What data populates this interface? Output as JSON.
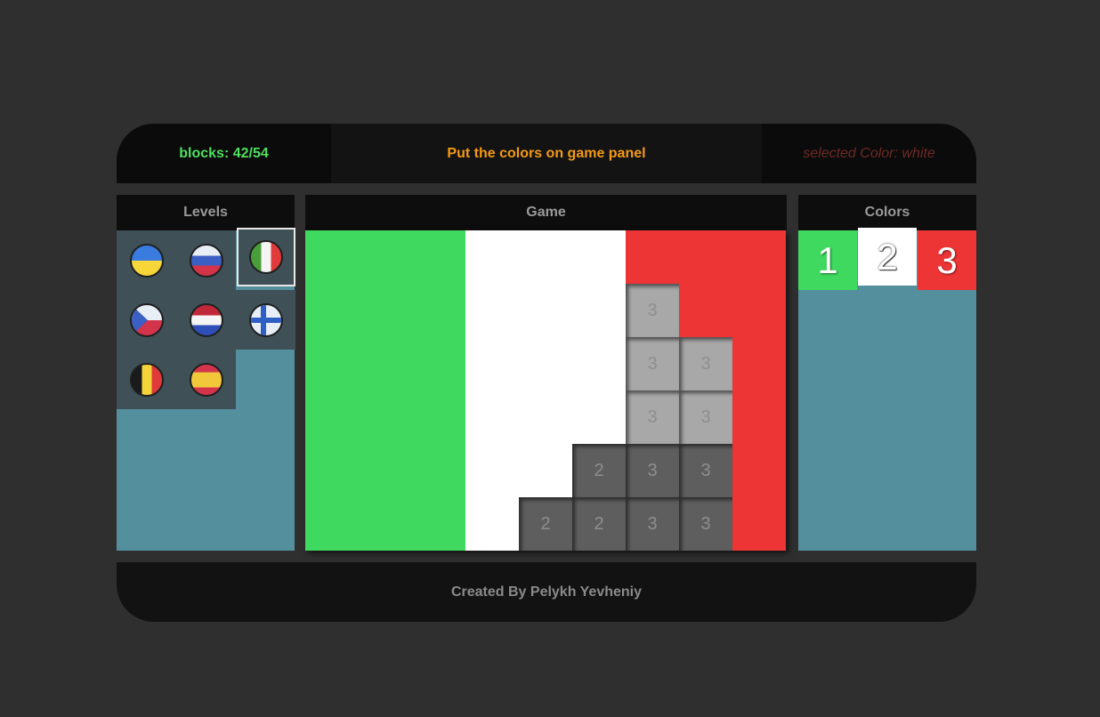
{
  "header": {
    "blocks": "blocks: 42/54",
    "instruction": "Put the colors on game panel",
    "selected_color": "selected Color: white"
  },
  "levels": {
    "title": "Levels",
    "items": [
      {
        "name": "ukraine",
        "colors": [
          "#3a7be0",
          "#f7d63a"
        ]
      },
      {
        "name": "russia",
        "colors": [
          "#e8eef5",
          "#3b5fc4",
          "#d3344a"
        ]
      },
      {
        "name": "italy",
        "colors": [
          "#4a9e3a",
          "#f4f4f4",
          "#e03a3a"
        ],
        "selected": true
      },
      {
        "name": "czech",
        "colors": [
          "#e8eef5",
          "#d3344a",
          "#3b5fc4"
        ]
      },
      {
        "name": "netherlands",
        "colors": [
          "#c0283a",
          "#f4f4f4",
          "#2f4fb8"
        ]
      },
      {
        "name": "finland",
        "colors": [
          "#e8eef5",
          "#2f5fc4"
        ]
      },
      {
        "name": "belgium",
        "colors": [
          "#1a1a1a",
          "#f5d43a",
          "#e03a3a"
        ]
      },
      {
        "name": "spain",
        "colors": [
          "#d3344a",
          "#f0c83a",
          "#d3344a"
        ]
      }
    ]
  },
  "game": {
    "title": "Game",
    "palette": {
      "1": "#3fd95f",
      "2": "#ffffff",
      "3": "#ee3535"
    },
    "grid": [
      [
        [
          1,
          1
        ],
        [
          1,
          1
        ],
        [
          1,
          1
        ],
        [
          2,
          1
        ],
        [
          2,
          1
        ],
        [
          2,
          1
        ],
        [
          3,
          1
        ],
        [
          3,
          1
        ],
        [
          3,
          1
        ]
      ],
      [
        [
          1,
          1
        ],
        [
          1,
          1
        ],
        [
          1,
          1
        ],
        [
          2,
          1
        ],
        [
          2,
          1
        ],
        [
          2,
          1
        ],
        [
          3,
          0
        ],
        [
          3,
          1
        ],
        [
          3,
          1
        ]
      ],
      [
        [
          1,
          1
        ],
        [
          1,
          1
        ],
        [
          1,
          1
        ],
        [
          2,
          1
        ],
        [
          2,
          1
        ],
        [
          2,
          1
        ],
        [
          3,
          0
        ],
        [
          3,
          0
        ],
        [
          3,
          1
        ]
      ],
      [
        [
          1,
          1
        ],
        [
          1,
          1
        ],
        [
          1,
          1
        ],
        [
          2,
          1
        ],
        [
          2,
          1
        ],
        [
          2,
          1
        ],
        [
          3,
          0
        ],
        [
          3,
          0
        ],
        [
          3,
          1
        ]
      ],
      [
        [
          1,
          1
        ],
        [
          1,
          1
        ],
        [
          1,
          1
        ],
        [
          2,
          1
        ],
        [
          2,
          1
        ],
        [
          2,
          0
        ],
        [
          3,
          0
        ],
        [
          3,
          0
        ],
        [
          3,
          1
        ]
      ],
      [
        [
          1,
          1
        ],
        [
          1,
          1
        ],
        [
          1,
          1
        ],
        [
          2,
          1
        ],
        [
          2,
          0
        ],
        [
          2,
          0
        ],
        [
          3,
          0
        ],
        [
          3,
          0
        ],
        [
          3,
          1
        ]
      ]
    ]
  },
  "colors": {
    "title": "Colors",
    "swatches": [
      {
        "label": "1",
        "color": "#3fd95f"
      },
      {
        "label": "2",
        "color": "#ffffff",
        "selected": true
      },
      {
        "label": "3",
        "color": "#ee3535"
      }
    ]
  },
  "footer": {
    "credit": "Created By Pelykh Yevheniy"
  }
}
